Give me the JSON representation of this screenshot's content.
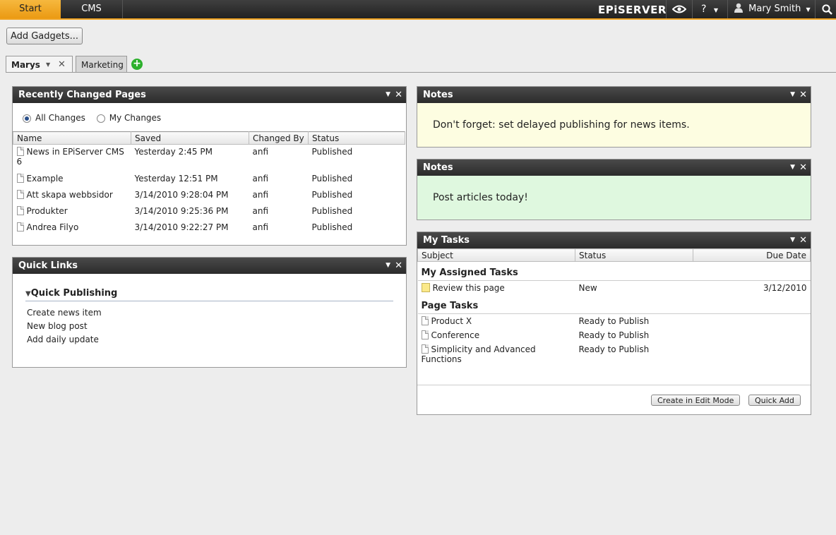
{
  "topbar": {
    "tab_start": "Start",
    "tab_cms": "CMS",
    "logo": "EPiSERVER",
    "view_icon": "eye-icon",
    "help_label": "?",
    "user_name": "Mary Smith",
    "search_icon": "search-icon",
    "accent_color": "#f0a21f"
  },
  "toolbar": {
    "add_gadgets_label": "Add Gadgets..."
  },
  "dashboard_tabs": [
    {
      "label": "Marys"
    },
    {
      "label": "Marketing"
    }
  ],
  "recently_changed": {
    "title": "Recently Changed Pages",
    "filter_all": "All Changes",
    "filter_mine": "My Changes",
    "columns": [
      "Name",
      "Saved",
      "Changed By",
      "Status"
    ],
    "rows": [
      {
        "name": "News in EPiServer CMS 6",
        "saved": "Yesterday 2:45 PM",
        "by": "anfi",
        "status": "Published"
      },
      {
        "name": "Example",
        "saved": "Yesterday 12:51 PM",
        "by": "anfi",
        "status": "Published"
      },
      {
        "name": "Att skapa webbsidor",
        "saved": "3/14/2010 9:28:04 PM",
        "by": "anfi",
        "status": "Published"
      },
      {
        "name": "Produkter",
        "saved": "3/14/2010 9:25:36 PM",
        "by": "anfi",
        "status": "Published"
      },
      {
        "name": "Andrea Filyo",
        "saved": "3/14/2010 9:22:27 PM",
        "by": "anfi",
        "status": "Published"
      }
    ]
  },
  "quick_links": {
    "title": "Quick Links",
    "section": "Quick Publishing",
    "links": [
      "Create news item",
      "New blog post",
      "Add daily update"
    ]
  },
  "notes": [
    {
      "title": "Notes",
      "text": "Don't forget: set delayed publishing for news items.",
      "color": "#fdfde1"
    },
    {
      "title": "Notes",
      "text": "Post articles today!",
      "color": "#dff8df"
    }
  ],
  "my_tasks": {
    "title": "My Tasks",
    "columns": [
      "Subject",
      "Status",
      "Due Date"
    ],
    "assigned_group": "My Assigned Tasks",
    "assigned": [
      {
        "subject": "Review this page",
        "status": "New",
        "due": "3/12/2010"
      }
    ],
    "page_group": "Page Tasks",
    "page_tasks": [
      {
        "subject": "Product X",
        "status": "Ready to Publish",
        "due": ""
      },
      {
        "subject": "Conference",
        "status": "Ready to Publish",
        "due": ""
      },
      {
        "subject": "Simplicity and Advanced Functions",
        "status": "Ready to Publish",
        "due": ""
      }
    ],
    "btn_create": "Create in Edit Mode",
    "btn_quick": "Quick Add"
  }
}
